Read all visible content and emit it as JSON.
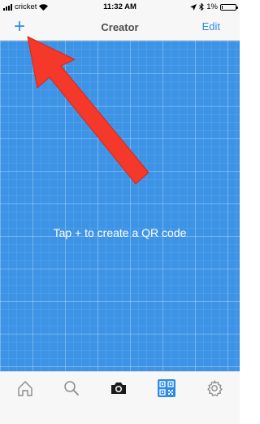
{
  "status_bar": {
    "carrier": "cricket",
    "time": "11:32 AM",
    "battery": "1%",
    "battery_level": 0.01
  },
  "nav": {
    "add_icon": "plus-icon",
    "add_label": "+",
    "title": "Creator",
    "edit_label": "Edit"
  },
  "main": {
    "hint": "Tap + to create a QR code"
  },
  "tabs": [
    {
      "name": "home",
      "icon": "home-icon"
    },
    {
      "name": "search",
      "icon": "search-icon"
    },
    {
      "name": "camera",
      "icon": "camera-icon"
    },
    {
      "name": "creator",
      "icon": "qr-code-icon",
      "selected": true
    },
    {
      "name": "settings",
      "icon": "gear-icon"
    }
  ],
  "colors": {
    "accent": "#2e8ce6",
    "canvas": "#3d94e6",
    "arrow": "#f4382a"
  }
}
